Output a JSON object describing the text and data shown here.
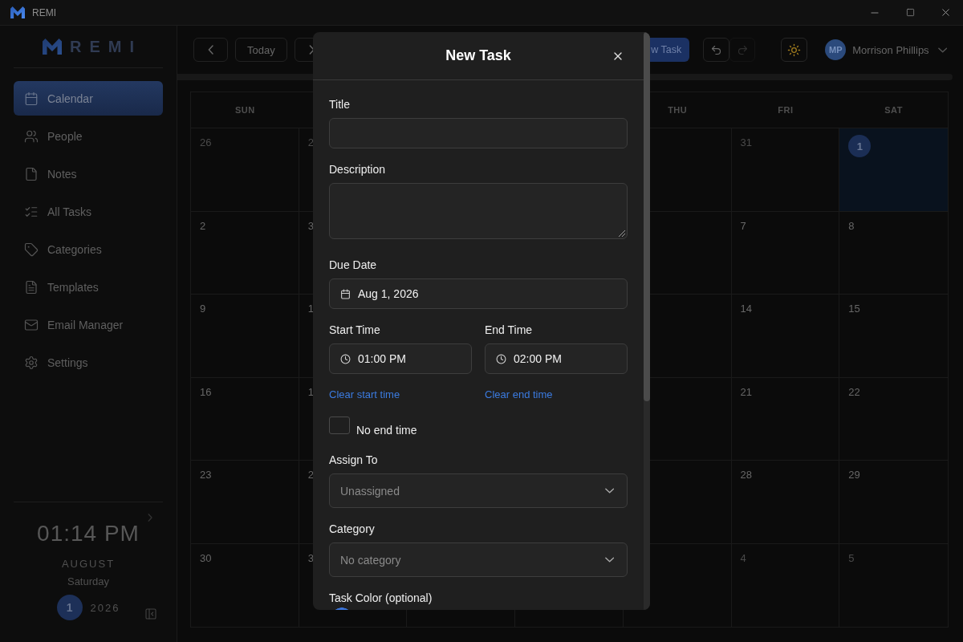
{
  "window": {
    "title": "REMI"
  },
  "sidebar": {
    "logo": "REMI",
    "items": [
      {
        "label": "Calendar",
        "selected": true
      },
      {
        "label": "People",
        "selected": false
      },
      {
        "label": "Notes",
        "selected": false
      },
      {
        "label": "All Tasks",
        "selected": false
      },
      {
        "label": "Categories",
        "selected": false
      },
      {
        "label": "Templates",
        "selected": false
      },
      {
        "label": "Email Manager",
        "selected": false
      },
      {
        "label": "Settings",
        "selected": false
      }
    ],
    "clock": {
      "time": "01:14 PM",
      "month": "AUGUST",
      "weekday": "Saturday",
      "day": "1",
      "year": "2026"
    }
  },
  "toolbar": {
    "today": "Today",
    "new_task": "w Task",
    "undo": {
      "disabled": false
    },
    "redo": {
      "disabled": true
    },
    "user": {
      "initials": "MP",
      "name": "Morrison Phillips"
    }
  },
  "calendar": {
    "columns": [
      {
        "heading": "SUN",
        "days": [
          {
            "label": "26",
            "muted": true,
            "selected": false
          },
          {
            "label": "2",
            "muted": false,
            "selected": false
          },
          {
            "label": "9",
            "muted": false,
            "selected": false
          },
          {
            "label": "16",
            "muted": false,
            "selected": false
          },
          {
            "label": "23",
            "muted": false,
            "selected": false
          },
          {
            "label": "30",
            "muted": false,
            "selected": false
          }
        ]
      },
      {
        "days": [
          {
            "label": "2",
            "muted": true,
            "selected": false
          },
          {
            "label": "3",
            "muted": false,
            "selected": false
          },
          {
            "label": "1",
            "muted": false,
            "selected": false
          },
          {
            "label": "1",
            "muted": false,
            "selected": false
          },
          {
            "label": "2",
            "muted": false,
            "selected": false
          },
          {
            "label": "3",
            "muted": false,
            "selected": false
          }
        ]
      },
      {
        "heading": "THU",
        "days": [
          {
            "selected": false
          },
          {
            "selected": false
          },
          {
            "selected": false
          },
          {
            "selected": false
          },
          {
            "selected": false
          },
          {
            "selected": false
          }
        ]
      },
      {
        "heading": "FRI",
        "days": [
          {
            "label": "31",
            "muted": true,
            "selected": false
          },
          {
            "label": "7",
            "muted": false,
            "selected": false
          },
          {
            "label": "14",
            "muted": false,
            "selected": false
          },
          {
            "label": "21",
            "muted": false,
            "selected": false
          },
          {
            "label": "28",
            "muted": false,
            "selected": false
          },
          {
            "label": "4",
            "muted": true,
            "selected": false
          }
        ]
      },
      {
        "heading": "SAT",
        "days": [
          {
            "label": "1",
            "muted": false,
            "selected": true
          },
          {
            "label": "8",
            "muted": false,
            "selected": false
          },
          {
            "label": "15",
            "muted": false,
            "selected": false
          },
          {
            "label": "22",
            "muted": false,
            "selected": false
          },
          {
            "label": "29",
            "muted": false,
            "selected": false
          },
          {
            "label": "5",
            "muted": true,
            "selected": false
          }
        ]
      }
    ]
  },
  "dialog": {
    "title": "New Task",
    "title_field": {
      "label": "Title"
    },
    "description": {
      "label": "Description"
    },
    "due_date": {
      "label": "Due Date",
      "value": "Aug 1, 2026"
    },
    "start_time": {
      "label": "Start Time",
      "value": "01:00 PM",
      "clear_link": "Clear start time"
    },
    "end_time": {
      "label": "End Time",
      "value": "02:00 PM",
      "clear_link": "Clear end time"
    },
    "no_end_time": {
      "label": "No end time",
      "checked": false
    },
    "assign_to": {
      "label": "Assign To",
      "value": "Unassigned"
    },
    "category": {
      "label": "Category",
      "value": "No category"
    },
    "task_color": {
      "label": "Task Color (optional)",
      "swatches": [
        {
          "color": "#3b74d9"
        }
      ]
    }
  }
}
